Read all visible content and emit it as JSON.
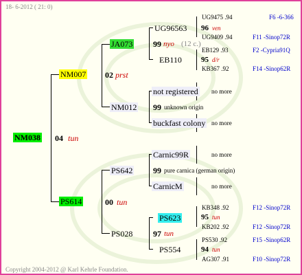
{
  "header": {
    "date": "18-  6-2012 ( 21:  0)"
  },
  "footer": {
    "copyright": "Copyright 2004-2012 @ Karl Kehrle Foundation."
  },
  "colors": {
    "root_bg": "#00ee00",
    "sire_bg": "#ffff00",
    "dam_bg": "#00ee00",
    "ja073_bg": "#33dd33",
    "ps623_bg": "#33eeee",
    "light_box": "#eeeef8"
  },
  "root": {
    "name": "NM038",
    "year": "04",
    "tag": "tun"
  },
  "gen1": {
    "sire": {
      "name": "NM007",
      "year": "02",
      "tag": "prst"
    },
    "dam": {
      "name": "PS614",
      "year": "00",
      "tag": "tun"
    }
  },
  "gen2": {
    "ja073": "JA073",
    "nm012": "NM012",
    "ps642": "PS642",
    "ps028": "PS028"
  },
  "ja073_parents": {
    "year": "99",
    "tag": "nyo",
    "extra": "(12 c.)",
    "sire": "UG96563",
    "dam": "EB110"
  },
  "nm012_parents": {
    "sire": "not registered",
    "year": "99",
    "origin": "unknown origin",
    "dam": "buckfast colony",
    "nomore1": "no more",
    "nomore2": "no more"
  },
  "ps642_parents": {
    "sire": "Carnic99R",
    "year": "99",
    "origin": "pure carnica (german origin)",
    "dam": "CarnicM",
    "nomore1": "no more",
    "nomore2": "no more"
  },
  "ps028_parents": {
    "year": "97",
    "tag": "tun",
    "sire": "PS623",
    "dam": "PS554"
  },
  "gen4": {
    "ug96563": {
      "top": "UG9475 .94",
      "top_ref": "F6 -6-366",
      "year": "96",
      "tag": "ven",
      "bottom": "UG9409 .94",
      "bottom_ref": "F11 -Sinop72R"
    },
    "eb110": {
      "top": "EB129 .93",
      "top_ref": "F2 -Cypria91Q",
      "year": "95",
      "tag": "d/r",
      "bottom": "KB367 .92",
      "bottom_ref": "F14 -Sinop62R"
    },
    "ps623": {
      "top": "KB348 .92",
      "top_ref": "F12 -Sinop72R",
      "year": "95",
      "tag": "tun",
      "bottom": "KB202 .92",
      "bottom_ref": "F12 -Sinop72R"
    },
    "ps554": {
      "top": "PS530 .92",
      "top_ref": "F15 -Sinop62R",
      "year": "94",
      "tag": "tun",
      "bottom": "AG307 .91",
      "bottom_ref": "F10 -Sinop72R"
    }
  }
}
